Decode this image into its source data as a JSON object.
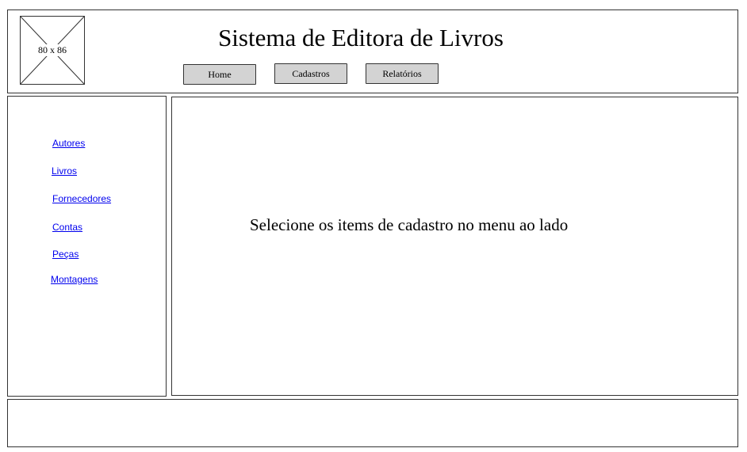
{
  "header": {
    "logo_placeholder": "80 x 86",
    "title": "Sistema de Editora de Livros",
    "nav": {
      "home": "Home",
      "cadastros": "Cadastros",
      "relatorios": "Relatórios"
    }
  },
  "sidebar": {
    "items": [
      {
        "label": "Autores"
      },
      {
        "label": "Livros"
      },
      {
        "label": "Fornecedores"
      },
      {
        "label": "Contas"
      },
      {
        "label": "Peças"
      },
      {
        "label": "Montagens"
      }
    ]
  },
  "main": {
    "message": "Selecione os items de cadastro no menu ao lado"
  },
  "footer": {}
}
